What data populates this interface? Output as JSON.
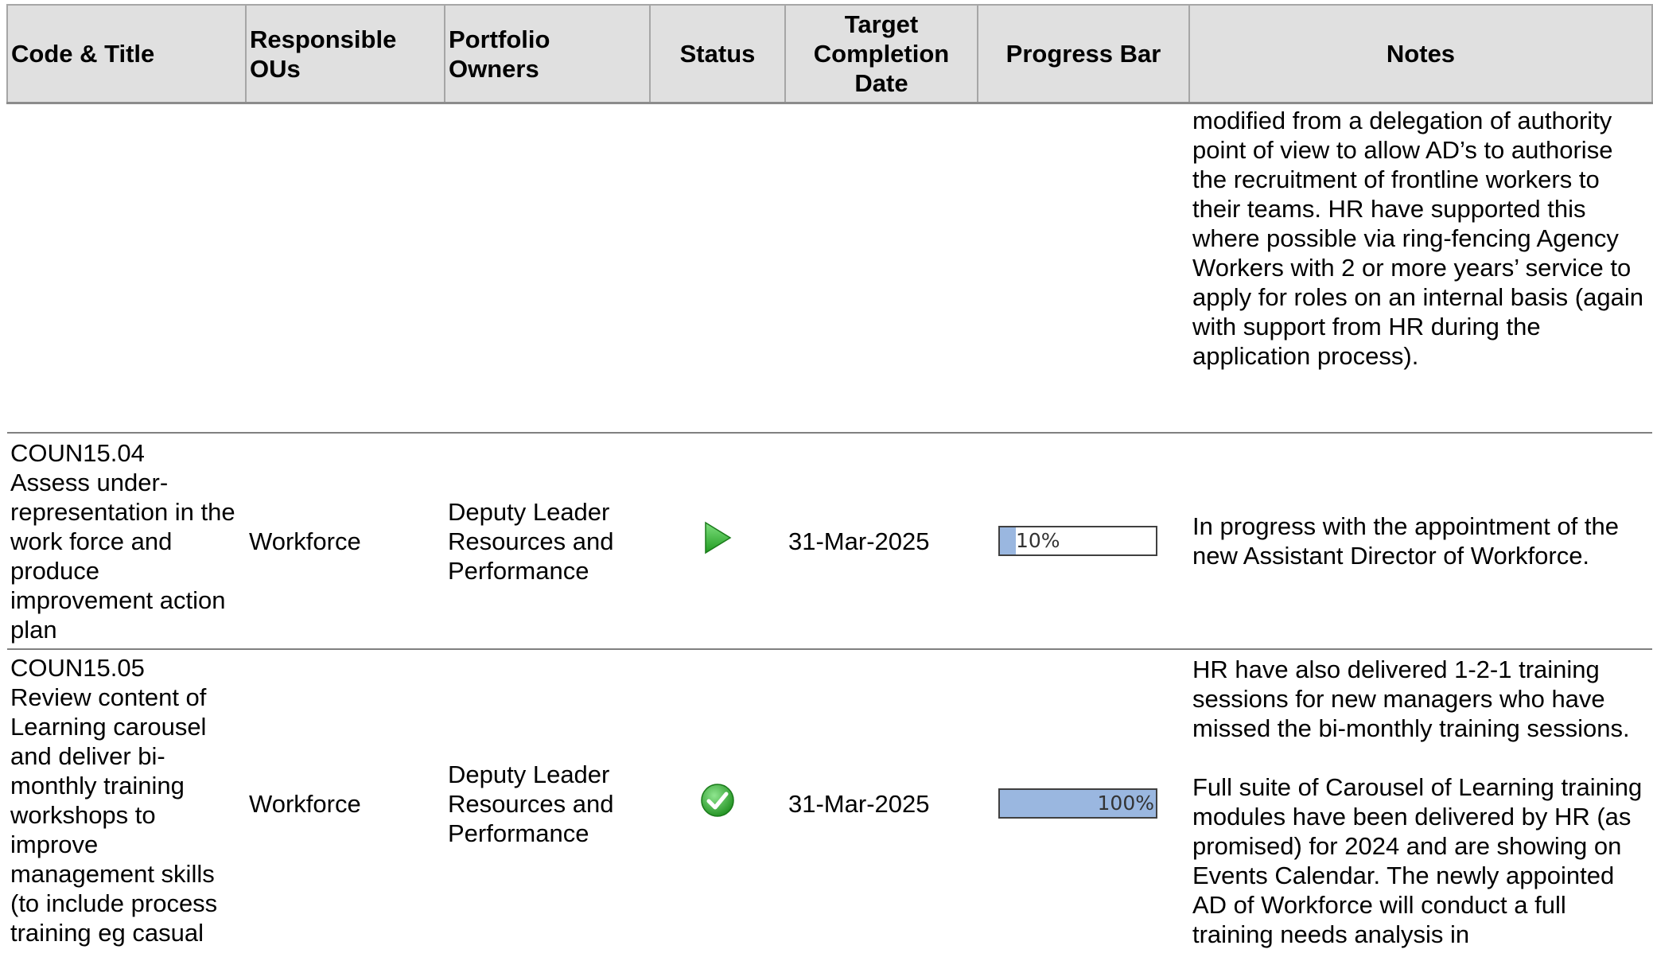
{
  "headers": {
    "code_title": "Code & Title",
    "responsible": "Responsible OUs",
    "portfolio": "Portfolio Owners",
    "status": "Status",
    "target_date": "Target Completion Date",
    "progress": "Progress Bar",
    "notes": "Notes"
  },
  "continued_row": {
    "notes": "modified from a delegation of authority point of view to allow AD’s to authorise the recruitment of frontline workers to their teams.  HR have supported this where possible via ring-fencing Agency Workers with 2 or more years’ service to apply for roles on an internal basis (again with support from HR during the application process)."
  },
  "rows": [
    {
      "code": "COUN15.04",
      "title": "Assess under-representation in the work force and produce improvement action plan",
      "responsible": "Workforce",
      "portfolio": "Deputy Leader Resources and Performance",
      "status_icon": "play-arrow-icon",
      "status_color": "#3cb43c",
      "target_date": "31-Mar-2025",
      "progress": 10,
      "progress_label": "10%",
      "notes": "In progress with the appointment of the new Assistant Director of Workforce."
    },
    {
      "code": "COUN15.05",
      "title": "Review content of Learning carousel and deliver bi-monthly training workshops to improve management skills (to include process training eg casual",
      "responsible": "Workforce",
      "portfolio": "Deputy Leader Resources and Performance",
      "status_icon": "check-circle-icon",
      "status_color": "#2fa52f",
      "target_date": "31-Mar-2025",
      "progress": 100,
      "progress_label": "100%",
      "notes": "HR have also delivered 1-2-1 training sessions for new managers who have missed the bi-monthly training sessions.\n\nFull suite of Carousel of Learning training modules have been delivered by HR (as promised) for 2024 and are showing on Events Calendar.  The newly appointed AD of Workforce will conduct a full training needs analysis in"
    }
  ],
  "colors": {
    "header_bg": "#e0e0e0",
    "progress_fill": "#9ab7e0"
  }
}
